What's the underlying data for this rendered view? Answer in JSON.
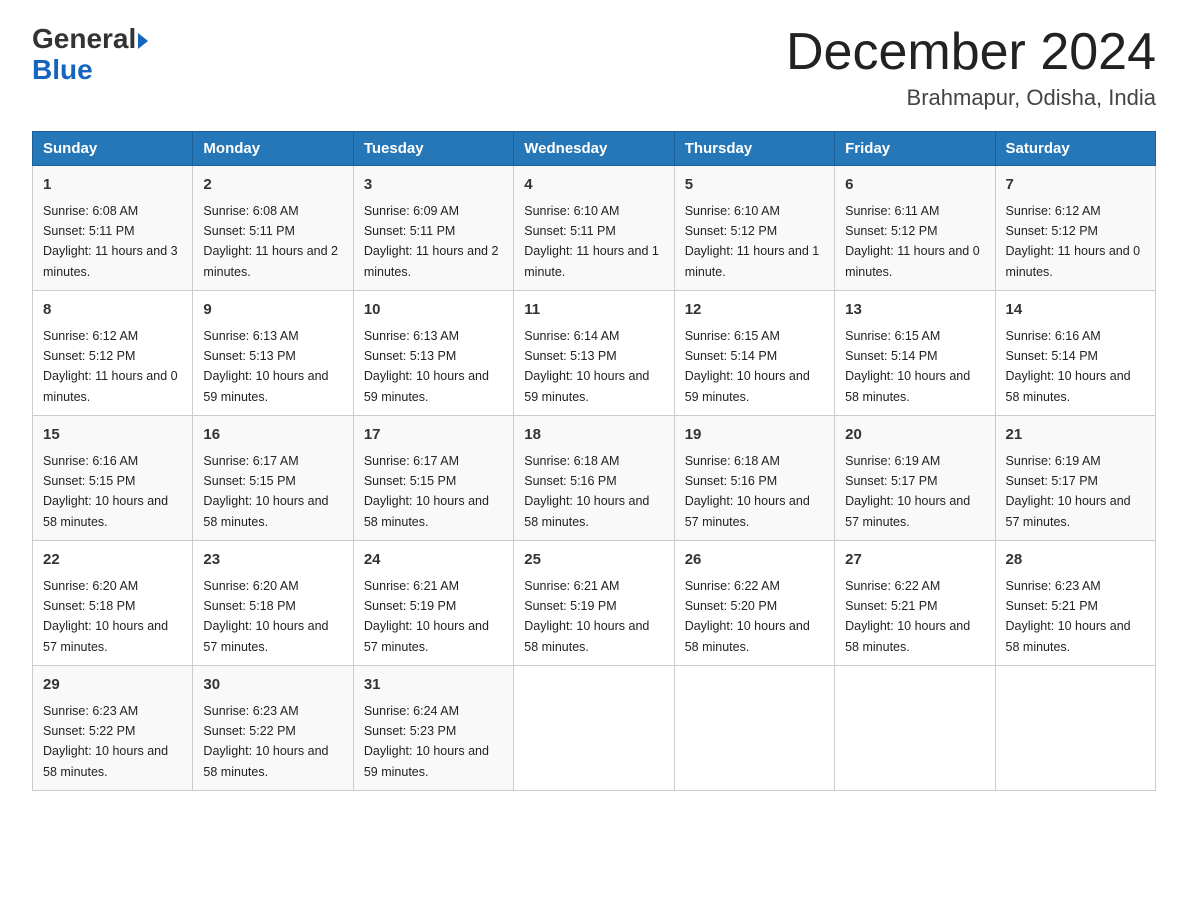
{
  "header": {
    "logo_text_general": "General",
    "logo_text_blue": "Blue",
    "month_year": "December 2024",
    "location": "Brahmapur, Odisha, India"
  },
  "days_of_week": [
    "Sunday",
    "Monday",
    "Tuesday",
    "Wednesday",
    "Thursday",
    "Friday",
    "Saturday"
  ],
  "weeks": [
    [
      {
        "day": "1",
        "sunrise": "6:08 AM",
        "sunset": "5:11 PM",
        "daylight": "11 hours and 3 minutes."
      },
      {
        "day": "2",
        "sunrise": "6:08 AM",
        "sunset": "5:11 PM",
        "daylight": "11 hours and 2 minutes."
      },
      {
        "day": "3",
        "sunrise": "6:09 AM",
        "sunset": "5:11 PM",
        "daylight": "11 hours and 2 minutes."
      },
      {
        "day": "4",
        "sunrise": "6:10 AM",
        "sunset": "5:11 PM",
        "daylight": "11 hours and 1 minute."
      },
      {
        "day": "5",
        "sunrise": "6:10 AM",
        "sunset": "5:12 PM",
        "daylight": "11 hours and 1 minute."
      },
      {
        "day": "6",
        "sunrise": "6:11 AM",
        "sunset": "5:12 PM",
        "daylight": "11 hours and 0 minutes."
      },
      {
        "day": "7",
        "sunrise": "6:12 AM",
        "sunset": "5:12 PM",
        "daylight": "11 hours and 0 minutes."
      }
    ],
    [
      {
        "day": "8",
        "sunrise": "6:12 AM",
        "sunset": "5:12 PM",
        "daylight": "11 hours and 0 minutes."
      },
      {
        "day": "9",
        "sunrise": "6:13 AM",
        "sunset": "5:13 PM",
        "daylight": "10 hours and 59 minutes."
      },
      {
        "day": "10",
        "sunrise": "6:13 AM",
        "sunset": "5:13 PM",
        "daylight": "10 hours and 59 minutes."
      },
      {
        "day": "11",
        "sunrise": "6:14 AM",
        "sunset": "5:13 PM",
        "daylight": "10 hours and 59 minutes."
      },
      {
        "day": "12",
        "sunrise": "6:15 AM",
        "sunset": "5:14 PM",
        "daylight": "10 hours and 59 minutes."
      },
      {
        "day": "13",
        "sunrise": "6:15 AM",
        "sunset": "5:14 PM",
        "daylight": "10 hours and 58 minutes."
      },
      {
        "day": "14",
        "sunrise": "6:16 AM",
        "sunset": "5:14 PM",
        "daylight": "10 hours and 58 minutes."
      }
    ],
    [
      {
        "day": "15",
        "sunrise": "6:16 AM",
        "sunset": "5:15 PM",
        "daylight": "10 hours and 58 minutes."
      },
      {
        "day": "16",
        "sunrise": "6:17 AM",
        "sunset": "5:15 PM",
        "daylight": "10 hours and 58 minutes."
      },
      {
        "day": "17",
        "sunrise": "6:17 AM",
        "sunset": "5:15 PM",
        "daylight": "10 hours and 58 minutes."
      },
      {
        "day": "18",
        "sunrise": "6:18 AM",
        "sunset": "5:16 PM",
        "daylight": "10 hours and 58 minutes."
      },
      {
        "day": "19",
        "sunrise": "6:18 AM",
        "sunset": "5:16 PM",
        "daylight": "10 hours and 57 minutes."
      },
      {
        "day": "20",
        "sunrise": "6:19 AM",
        "sunset": "5:17 PM",
        "daylight": "10 hours and 57 minutes."
      },
      {
        "day": "21",
        "sunrise": "6:19 AM",
        "sunset": "5:17 PM",
        "daylight": "10 hours and 57 minutes."
      }
    ],
    [
      {
        "day": "22",
        "sunrise": "6:20 AM",
        "sunset": "5:18 PM",
        "daylight": "10 hours and 57 minutes."
      },
      {
        "day": "23",
        "sunrise": "6:20 AM",
        "sunset": "5:18 PM",
        "daylight": "10 hours and 57 minutes."
      },
      {
        "day": "24",
        "sunrise": "6:21 AM",
        "sunset": "5:19 PM",
        "daylight": "10 hours and 57 minutes."
      },
      {
        "day": "25",
        "sunrise": "6:21 AM",
        "sunset": "5:19 PM",
        "daylight": "10 hours and 58 minutes."
      },
      {
        "day": "26",
        "sunrise": "6:22 AM",
        "sunset": "5:20 PM",
        "daylight": "10 hours and 58 minutes."
      },
      {
        "day": "27",
        "sunrise": "6:22 AM",
        "sunset": "5:21 PM",
        "daylight": "10 hours and 58 minutes."
      },
      {
        "day": "28",
        "sunrise": "6:23 AM",
        "sunset": "5:21 PM",
        "daylight": "10 hours and 58 minutes."
      }
    ],
    [
      {
        "day": "29",
        "sunrise": "6:23 AM",
        "sunset": "5:22 PM",
        "daylight": "10 hours and 58 minutes."
      },
      {
        "day": "30",
        "sunrise": "6:23 AM",
        "sunset": "5:22 PM",
        "daylight": "10 hours and 58 minutes."
      },
      {
        "day": "31",
        "sunrise": "6:24 AM",
        "sunset": "5:23 PM",
        "daylight": "10 hours and 59 minutes."
      },
      null,
      null,
      null,
      null
    ]
  ],
  "labels": {
    "sunrise_prefix": "Sunrise: ",
    "sunset_prefix": "Sunset: ",
    "daylight_prefix": "Daylight: "
  }
}
